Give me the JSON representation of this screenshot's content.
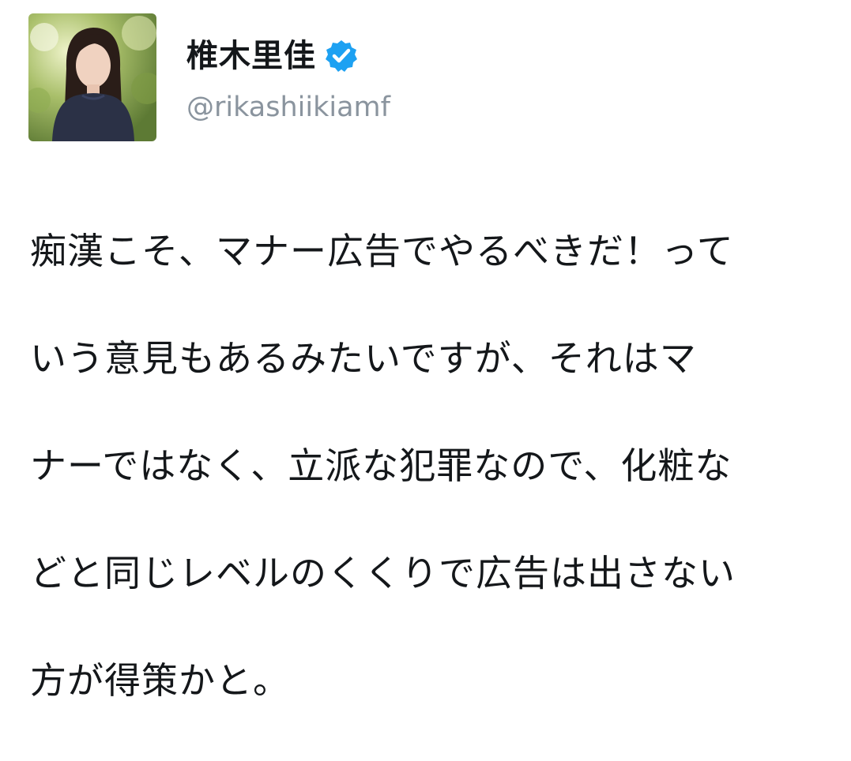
{
  "tweet": {
    "display_name": "椎木里佳",
    "handle": "@rikashiikiamf",
    "verified": true,
    "verified_icon": "verified-badge-icon",
    "accent_color": "#1da1f2",
    "avatar_description": "profile-photo",
    "text_lines": [
      "痴漢こそ、マナー広告でやるべきだ！って",
      "いう意見もあるみたいですが、それはマ",
      "ナーではなく、立派な犯罪なので、化粧な",
      "どと同じレベルのくくりで広告は出さない",
      "方が得策かと。"
    ]
  }
}
